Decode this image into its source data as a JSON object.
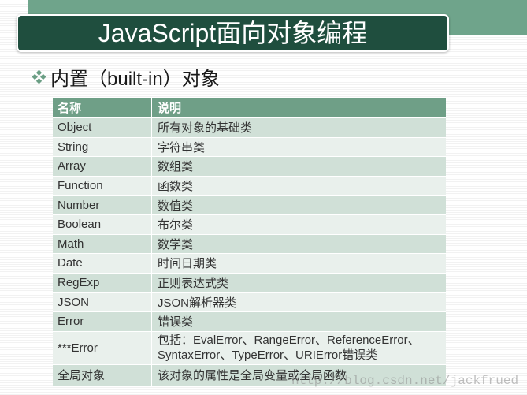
{
  "slide": {
    "title": "JavaScript面向对象编程",
    "subheading": {
      "icon": "diamond-bullet-icon",
      "text": "内置（built-in）对象"
    },
    "table": {
      "columns": [
        "名称",
        "说明"
      ],
      "rows": [
        {
          "name": "Object",
          "desc": [
            "所有对象的基础类"
          ]
        },
        {
          "name": "String",
          "desc": [
            "字符串类"
          ]
        },
        {
          "name": "Array",
          "desc": [
            "数组类"
          ]
        },
        {
          "name": "Function",
          "desc": [
            "函数类"
          ]
        },
        {
          "name": "Number",
          "desc": [
            "数值类"
          ]
        },
        {
          "name": "Boolean",
          "desc": [
            "布尔类"
          ]
        },
        {
          "name": "Math",
          "desc": [
            "数学类"
          ]
        },
        {
          "name": "Date",
          "desc": [
            "时间日期类"
          ]
        },
        {
          "name": "RegExp",
          "desc": [
            "正则表达式类"
          ]
        },
        {
          "name": "JSON",
          "desc": [
            "JSON解析器类"
          ]
        },
        {
          "name": "Error",
          "desc": [
            "错误类"
          ]
        },
        {
          "name": "***Error",
          "desc": [
            "包括：EvalError、RangeError、ReferenceError、",
            "SyntaxError、TypeError、URIError错误类"
          ]
        },
        {
          "name": "全局对象",
          "desc": [
            "该对象的属性是全局变量或全局函数"
          ]
        }
      ]
    },
    "watermark": "http://blog.csdn.net/jackfrued"
  },
  "colors": {
    "top_band": "#6fa48b",
    "title_bar": "#1f4e3e",
    "table_header": "#6f9f87",
    "row_band_dark": "#d0e0d7",
    "row_band_light": "#e9f0ec",
    "bullet": "#6a9e84",
    "cell_text": "#333333",
    "heading_text": "#1a1a1a"
  }
}
